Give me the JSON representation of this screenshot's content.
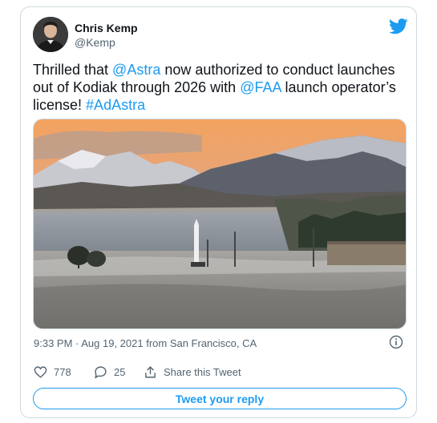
{
  "author": {
    "name": "Chris Kemp",
    "handle": "@Kemp"
  },
  "tweet": {
    "part1": "Thrilled that ",
    "mention_astra": "@Astra",
    "part2": " now authorized to conduct launches out of Kodiak through 2026 with ",
    "mention_faa": "@FAA",
    "part3": " launch operator’s license! ",
    "hashtag": "#AdAstra"
  },
  "meta": {
    "timestamp": "9:33 PM · Aug 19, 2021 from San Francisco, CA"
  },
  "actions": {
    "likes": "778",
    "replies": "25",
    "share_label": "Share this Tweet"
  },
  "reply_button": "Tweet your reply",
  "colors": {
    "accent": "#1d9bf0",
    "text": "#0f1419",
    "muted": "#536471",
    "border": "#cfd9de"
  },
  "icons": [
    "twitter-bird-icon",
    "info-icon",
    "heart-icon",
    "reply-bubble-icon",
    "share-icon"
  ]
}
